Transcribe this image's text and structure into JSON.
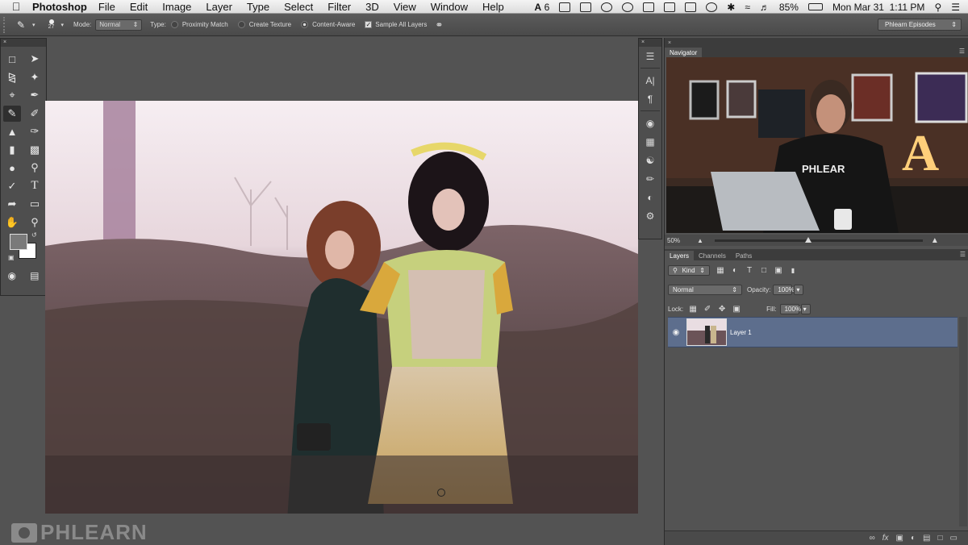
{
  "menubar": {
    "app_name": "Photoshop",
    "menus": [
      "File",
      "Edit",
      "Image",
      "Layer",
      "Type",
      "Select",
      "Filter",
      "3D",
      "View",
      "Window",
      "Help"
    ],
    "status": {
      "adobe_count": "6",
      "battery": "85%",
      "datetime": "Mon Mar 31  1:11 PM"
    }
  },
  "options_bar": {
    "brush_size": "27",
    "mode_label": "Mode:",
    "mode_value": "Normal",
    "type_label": "Type:",
    "type_options": [
      "Proximity Match",
      "Create Texture",
      "Content-Aware"
    ],
    "selected_type": "Content-Aware",
    "sample_all_layers": "Sample All Layers",
    "workspace": "Phlearn Episodes"
  },
  "tools": {
    "icons": [
      "marquee-icon",
      "move-icon",
      "lasso-icon",
      "magic-wand-icon",
      "crop-icon",
      "eyedropper-icon",
      "spot-healing-brush-icon",
      "brush-icon",
      "clone-stamp-icon",
      "history-brush-icon",
      "eraser-icon",
      "gradient-icon",
      "blur-icon",
      "dodge-icon",
      "pen-icon",
      "type-icon",
      "path-selection-icon",
      "rectangle-icon",
      "hand-icon",
      "zoom-icon"
    ],
    "selected": "spot-healing-brush-icon",
    "foreground_color": "#7a7a7a",
    "background_color": "#ffffff"
  },
  "navigator": {
    "tab": "Navigator",
    "zoom": "50%"
  },
  "layers_panel": {
    "tabs": [
      "Layers",
      "Channels",
      "Paths"
    ],
    "filter_kind": "Kind",
    "blend_mode": "Normal",
    "opacity_label": "Opacity:",
    "opacity_value": "100%",
    "lock_label": "Lock:",
    "fill_label": "Fill:",
    "fill_value": "100%",
    "layers": [
      {
        "name": "Layer 1",
        "visible": true,
        "selected": true
      }
    ]
  },
  "watermark": "PHLEARN",
  "colors": {
    "selected_layer": "#5d6e8d",
    "panel_bg": "#535353"
  }
}
